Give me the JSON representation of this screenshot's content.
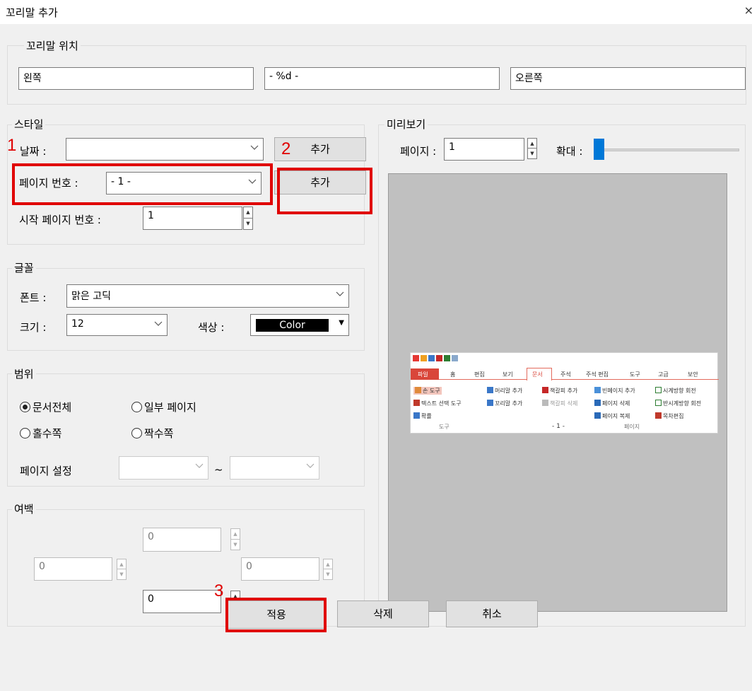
{
  "window": {
    "title": "꼬리말 추가",
    "close_glyph": "×"
  },
  "position_group": {
    "legend": "꼬리말 위치",
    "left": "왼쪽",
    "center": "- %d -",
    "right": "오른쪽"
  },
  "style_group": {
    "legend": "스타일",
    "date_label": "날짜 :",
    "date_value": "",
    "add_label": "추가",
    "page_number_label": "페이지 번호 :",
    "page_number_value": "- 1 -",
    "start_page_label": "시작 페이지 번호 :",
    "start_page_value": "1"
  },
  "font_group": {
    "legend": "글꼴",
    "font_label": "폰트 :",
    "font_value": "맑은 고딕",
    "size_label": "크기 :",
    "size_value": "12",
    "color_label": "색상 :",
    "color_value": "Color"
  },
  "range_group": {
    "legend": "범위",
    "all": "문서전체",
    "some": "일부 페이지",
    "odd": "홀수쪽",
    "even": "짝수쪽",
    "selected": "all",
    "page_setting_label": "페이지 설정",
    "tilde": "~"
  },
  "margin_group": {
    "legend": "여백",
    "top": "0",
    "left": "0",
    "right": "0",
    "bottom": "0"
  },
  "preview_group": {
    "legend": "미리보기",
    "page_label": "페이지 :",
    "page_value": "1",
    "zoom_label": "확대 :",
    "zoom_level": 0
  },
  "thumbnail": {
    "tabs": [
      "파일",
      "홈",
      "편집",
      "보기",
      "문서",
      "주석",
      "주석 편집",
      "도구",
      "고급",
      "보안"
    ],
    "active_tab": "문서",
    "items": {
      "hand": "손 도구",
      "text_select": "텍스트 선택 도구",
      "zoom": "확률",
      "tool_group": "도구",
      "header_add": "머리말 추가",
      "footer_add": "꼬리말 추가",
      "bookmark_add": "책갈피 추가",
      "bookmark_delete": "책갈피 삭제",
      "footer_preview": "- 1 -",
      "blank_add": "빈페이지 추가",
      "page_delete": "페이지 삭제",
      "page_copy": "페이지 복제",
      "page_group": "페이지",
      "rotate_cw": "시계방향 회전",
      "rotate_ccw": "반시계방향 회전",
      "toc_edit": "목차편집"
    }
  },
  "annotations": {
    "n1": "1",
    "n2": "2",
    "n3": "3"
  },
  "actions": {
    "apply": "적용",
    "delete": "삭제",
    "cancel": "취소"
  },
  "colors": {
    "annotation_red": "#e00000",
    "swatch": "#000000",
    "slider_thumb": "#0078d7",
    "active_tab": "#d9463a"
  }
}
